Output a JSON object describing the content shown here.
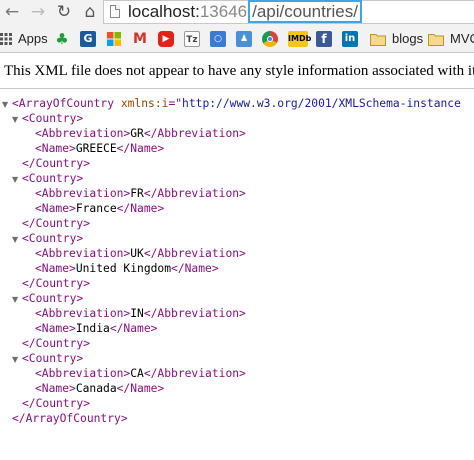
{
  "toolbar": {
    "back_icon": "arrow-left-icon",
    "forward_icon": "arrow-right-icon",
    "reload_icon": "reload-icon",
    "home_icon": "home-icon",
    "url_host": "localhost:",
    "url_port": "13646",
    "url_path": "/api/countries/"
  },
  "bookmarks": {
    "apps_label": "Apps",
    "blogs_label": "blogs",
    "mvc_label": "MVC",
    "icons": [
      "shamrock-icon",
      "g-icon",
      "windows-icon",
      "gmail-icon",
      "youtube-icon",
      "tz-icon",
      "zones-icon",
      "people-icon",
      "chrome-icon",
      "imdb-icon",
      "facebook-icon",
      "linkedin-icon"
    ],
    "imdb_text": "IMDb"
  },
  "info_message": "This XML file does not appear to have any style information associated with it. The",
  "xml": {
    "root_open": "<ArrayOfCountry ",
    "root_attr": "xmlns:i",
    "root_eq": "=\"",
    "root_val": "http://www.w3.org/2001/XMLSchema-instance",
    "root_close": "</ArrayOfCountry>",
    "country_open": "<Country>",
    "country_close": "</Country>",
    "abbr_open": "<Abbreviation>",
    "abbr_close": "</Abbreviation>",
    "name_open": "<Name>",
    "name_close": "</Name>",
    "countries": [
      {
        "abbreviation": "GR",
        "name": "GREECE"
      },
      {
        "abbreviation": "FR",
        "name": "France"
      },
      {
        "abbreviation": "UK",
        "name": "United Kingdom"
      },
      {
        "abbreviation": "IN",
        "name": "India"
      },
      {
        "abbreviation": "CA",
        "name": "Canada"
      }
    ]
  },
  "colors": {
    "tag": "#881280",
    "attribute": "#994500",
    "value": "#1a1aa6",
    "address_highlight": "#3fa6e6"
  }
}
